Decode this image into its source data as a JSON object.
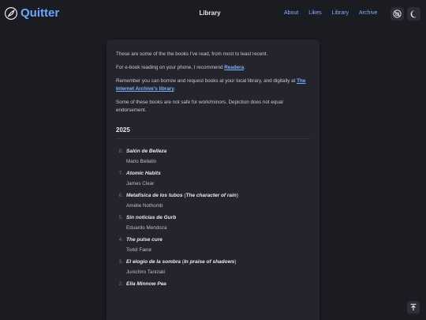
{
  "header": {
    "site_name": "Quitter",
    "page_heading": "Library",
    "nav": [
      {
        "label": "About"
      },
      {
        "label": "Likes"
      },
      {
        "label": "Library"
      },
      {
        "label": "Archive"
      }
    ],
    "icons": [
      "no-ai-icon",
      "moon-icon"
    ]
  },
  "intro": {
    "p1": "These are some of the the books I've read, from most to least recent.",
    "p2_before": "For e-book reading on your phone, I recommend ",
    "p2_link": "Readera",
    "p2_after": ".",
    "p3_before": "Remember you can borrow and request books at your local library, and digitally at ",
    "p3_link": "The Internet Archive's library",
    "p3_after": ".",
    "p4": "Some of these books are not safe for work/minors. Depiction does not equal endorsement."
  },
  "year": "2025",
  "books": [
    {
      "num": "8.",
      "title": "Salón de Belleza",
      "alt_title": "",
      "author": "Mario Bellatin"
    },
    {
      "num": "7.",
      "title": "Atomic Habits",
      "alt_title": "",
      "author": "James Clear"
    },
    {
      "num": "6.",
      "title": "Metafísica de los tubos",
      "alt_title": "The character of rain",
      "author": "Amélie Nothomb"
    },
    {
      "num": "5.",
      "title": "Sin noticias de Gurb",
      "alt_title": "",
      "author": "Eduardo Mendoza"
    },
    {
      "num": "4.",
      "title": "The pulse cure",
      "alt_title": "",
      "author": "Torkil Færø"
    },
    {
      "num": "3.",
      "title": "El elogio de la sombra",
      "alt_title": "In praise of shadows",
      "author": "Junichiro Tanizaki"
    },
    {
      "num": "2.",
      "title": "Ella Minnow Pea",
      "alt_title": "",
      "author": ""
    }
  ],
  "colors": {
    "background": "#1b1b22",
    "panel": "#24242d",
    "accent": "#6aa7ff"
  }
}
